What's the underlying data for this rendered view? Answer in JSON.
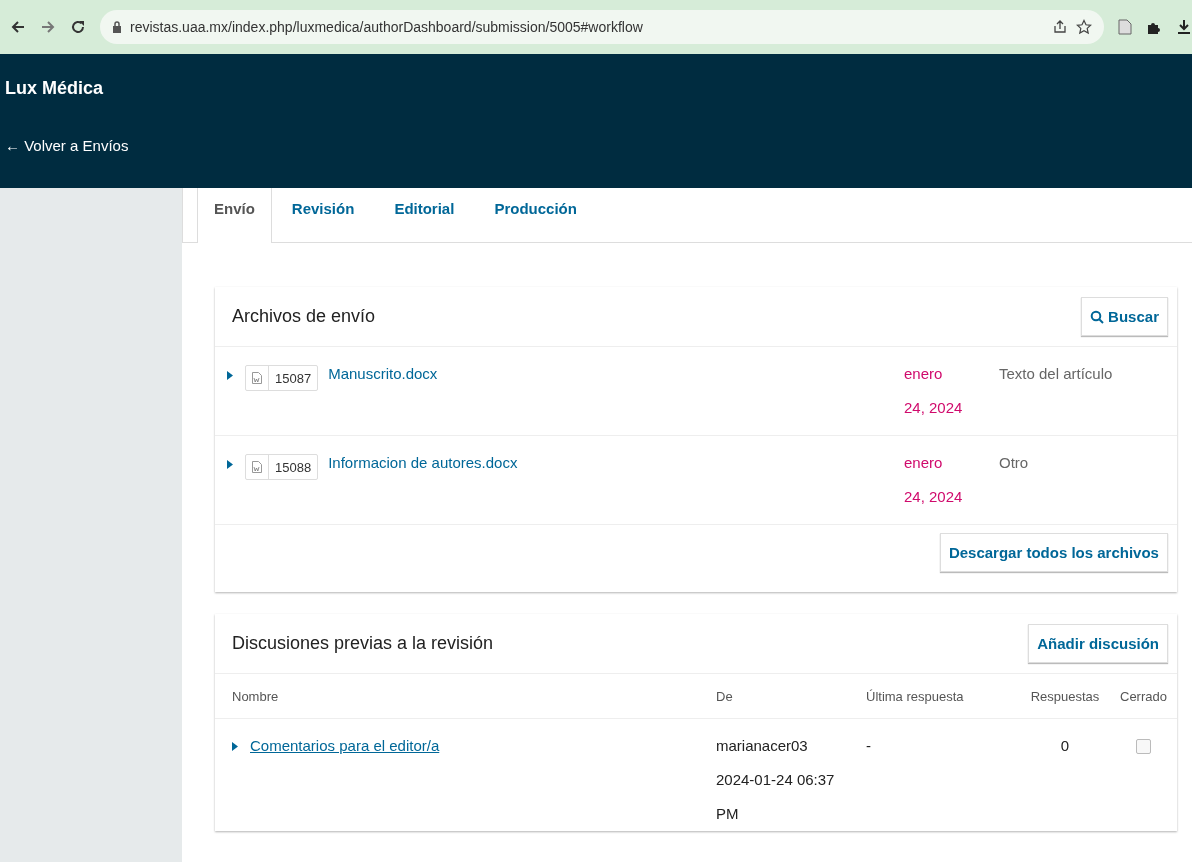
{
  "browser": {
    "url": "revistas.uaa.mx/index.php/luxmedica/authorDashboard/submission/5005#workflow"
  },
  "header": {
    "title": "Lux Médica",
    "back_link": "← Volver a Envíos"
  },
  "tabs": [
    {
      "label": "Envío",
      "selected": true
    },
    {
      "label": "Revisión",
      "selected": false
    },
    {
      "label": "Editorial",
      "selected": false
    },
    {
      "label": "Producción",
      "selected": false
    }
  ],
  "files_panel": {
    "title": "Archivos de envío",
    "search_button": "Buscar",
    "files": [
      {
        "id": "15087",
        "name": "Manuscrito.docx",
        "date": "enero 24, 2024",
        "type": "Texto del artículo"
      },
      {
        "id": "15088",
        "name": "Informacion de autores.docx",
        "date": "enero 24, 2024",
        "type": "Otro"
      }
    ],
    "download_button": "Descargar todos los archivos"
  },
  "discussions_panel": {
    "title": "Discusiones previas a la revisión",
    "add_button": "Añadir discusión",
    "columns": [
      "Nombre",
      "De",
      "Última respuesta",
      "Respuestas",
      "Cerrado"
    ],
    "rows": [
      {
        "name": "Comentarios para el editor/a",
        "from": "marianacer03 2024-01-24 06:37 PM",
        "last_reply": "-",
        "replies": "0",
        "closed": false
      }
    ]
  }
}
